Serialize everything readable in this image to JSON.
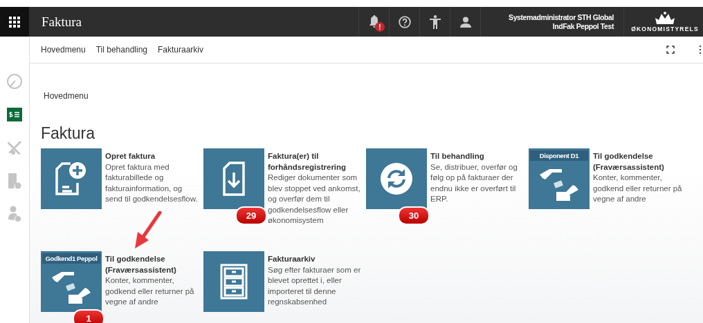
{
  "app_bar": {
    "title": "Faktura",
    "notification_badge": "!",
    "user_name": "Systemadministrator STH Global",
    "user_org": "IndFak Peppol Test",
    "logo_text": "ØKONOMISTYRELS"
  },
  "nav": [
    {
      "label": "Hovedmenu"
    },
    {
      "label": "Til behandling"
    },
    {
      "label": "Fakturaarkiv"
    }
  ],
  "sidebar": [
    {
      "kind": "gauge",
      "selected": false
    },
    {
      "kind": "invoice",
      "selected": true
    },
    {
      "kind": "plane",
      "selected": false
    },
    {
      "kind": "document",
      "selected": false
    },
    {
      "kind": "person",
      "selected": false
    }
  ],
  "breadcrumb": "Hovedmenu",
  "heading": "Faktura",
  "tiles": [
    {
      "kind": "create",
      "title": "Opret faktura",
      "description": "Opret faktura med fakturabillede og fakturainformation, og send til godkendelsesflow."
    },
    {
      "kind": "download",
      "title": "Faktura(er) til forhåndsregistrering",
      "description": "Rediger dokumenter som blev stoppet ved ankomst, og overfør dem til godkendelsesflow eller økonomisystem",
      "count": "29"
    },
    {
      "kind": "sync",
      "title": "Til behandling",
      "description": "Se, distribuer, overfør og følg op på fakturaer der endnu ikke er overført til ERP.",
      "count": "30"
    },
    {
      "kind": "hands",
      "title": "Til godkendelse (Fraværsassistent)",
      "description": "Konter, kommenter, godkend eller returner på vegne af andre",
      "tag": "Disponent D1"
    },
    {
      "kind": "hands",
      "title": "Til godkendelse (Fraværsassistent)",
      "description": "Konter, kommenter, godkend eller returner på vegne af andre",
      "tag": "Godkend1 Peppol",
      "count": "1"
    },
    {
      "kind": "archive",
      "title": "Fakturaarkiv",
      "description": "Søg efter fakturaer som er blevet oprettet i, eller importeret til denne regnskabsenhed"
    }
  ]
}
